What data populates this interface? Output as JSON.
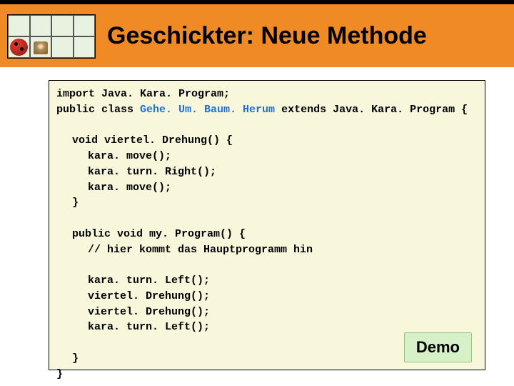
{
  "header": {
    "title": "Geschickter: Neue Methode"
  },
  "code": {
    "line1a": "import",
    "line1b": " Java. Kara. Program;",
    "line2a": "public class ",
    "line2b": "Gehe. Um. Baum. Herum",
    "line2c": " extends",
    "line2d": " Java. Kara. Program {",
    "m1_a": "void",
    "m1_b": " viertel. Drehung() {",
    "m1_l1": "kara. move();",
    "m1_l2": "kara. turn. Right();",
    "m1_l3": "kara. move();",
    "m1_close": "}",
    "m2_a": "public void",
    "m2_b": " my. Program() {",
    "m2_c1": "// hier kommt das Hauptprogramm hin",
    "m2_l1": "kara. turn. Left();",
    "m2_l2": "viertel. Drehung();",
    "m2_l3": "viertel. Drehung();",
    "m2_l4": "kara. turn. Left();",
    "m2_close": "}",
    "class_close": "}"
  },
  "demo_label": "Demo"
}
